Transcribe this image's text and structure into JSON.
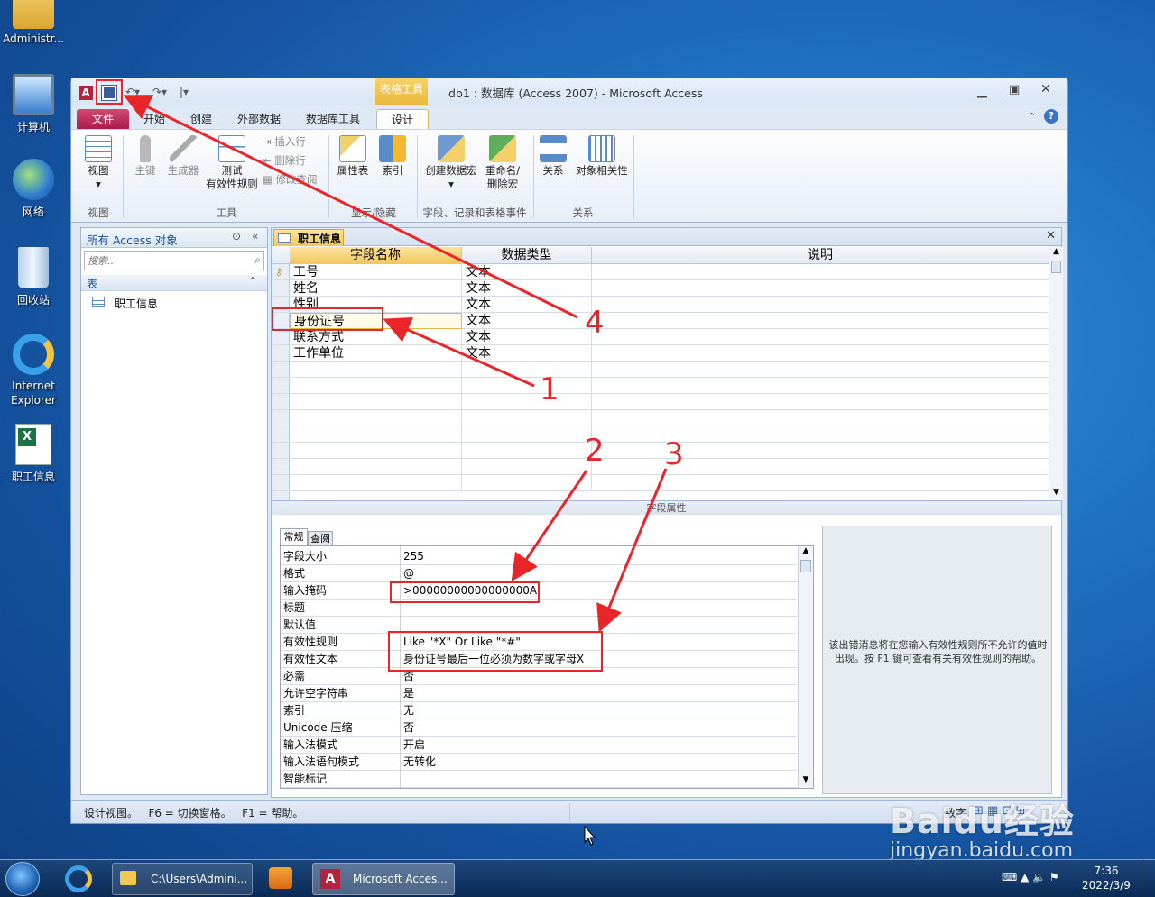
{
  "desktop": {
    "icons": [
      {
        "label": "Administr..."
      },
      {
        "label": "计算机"
      },
      {
        "label": "网络"
      },
      {
        "label": "回收站"
      },
      {
        "label": "Internet Explorer"
      },
      {
        "label": "职工信息"
      }
    ]
  },
  "window": {
    "title": "db1 : 数据库 (Access 2007)  -  Microsoft Access",
    "context_tab": "表格工具"
  },
  "tabs": [
    "文件",
    "开始",
    "创建",
    "外部数据",
    "数据库工具",
    "设计"
  ],
  "ribbon": {
    "view": "视图",
    "view_group": "视图",
    "primary_key": "主键",
    "builder": "生成器",
    "test_rules": "测试\n有效性规则",
    "insert_row": "插入行",
    "delete_row": "删除行",
    "modify_lookup": "修改查阅",
    "tools_group": "工具",
    "property_sheet": "属性表",
    "indexes": "索引",
    "show_hide_group": "显示/隐藏",
    "create_macro": "创建数据宏",
    "rename_macro": "重命名/\n删除宏",
    "events_group": "字段、记录和表格事件",
    "relationships": "关系",
    "dependencies": "对象相关性",
    "relations_group": "关系"
  },
  "nav": {
    "header": "所有 Access 对象",
    "search_placeholder": "搜索...",
    "section": "表",
    "item": "职工信息"
  },
  "doc": {
    "tab_label": "职工信息",
    "headers": [
      "字段名称",
      "数据类型",
      "说明"
    ],
    "rows": [
      {
        "name": "工号",
        "type": "文本"
      },
      {
        "name": "姓名",
        "type": "文本"
      },
      {
        "name": "性别",
        "type": "文本"
      },
      {
        "name": "身份证号",
        "type": "文本"
      },
      {
        "name": "联系方式",
        "type": "文本"
      },
      {
        "name": "工作单位",
        "type": "文本"
      }
    ],
    "field_props_title": "字段属性",
    "prop_tabs": [
      "常规",
      "查阅"
    ],
    "props": [
      {
        "k": "字段大小",
        "v": "255"
      },
      {
        "k": "格式",
        "v": "@"
      },
      {
        "k": "输入掩码",
        "v": ">00000000000000000A"
      },
      {
        "k": "标题",
        "v": ""
      },
      {
        "k": "默认值",
        "v": ""
      },
      {
        "k": "有效性规则",
        "v": "Like \"*X\" Or Like \"*#\""
      },
      {
        "k": "有效性文本",
        "v": "身份证号最后一位必须为数字或字母X"
      },
      {
        "k": "必需",
        "v": "否"
      },
      {
        "k": "允许空字符串",
        "v": "是"
      },
      {
        "k": "索引",
        "v": "无"
      },
      {
        "k": "Unicode 压缩",
        "v": "否"
      },
      {
        "k": "输入法模式",
        "v": "开启"
      },
      {
        "k": "输入法语句模式",
        "v": "无转化"
      },
      {
        "k": "智能标记",
        "v": ""
      }
    ],
    "help_text": "该出错消息将在您输入有效性规则所不允许的值时出现。按 F1 键可查看有关有效性规则的帮助。"
  },
  "status": {
    "left": "设计视图。   F6 = 切换窗格。   F1 = 帮助。",
    "right": "数字"
  },
  "annotations": [
    "1",
    "2",
    "3",
    "4"
  ],
  "taskbar": {
    "explorer": "C:\\Users\\Admini...",
    "access": "Microsoft Acces...",
    "time": "7:36",
    "date": "2022/3/9"
  },
  "watermark": {
    "brand": "Baidu经验",
    "url": "jingyan.baidu.com"
  }
}
